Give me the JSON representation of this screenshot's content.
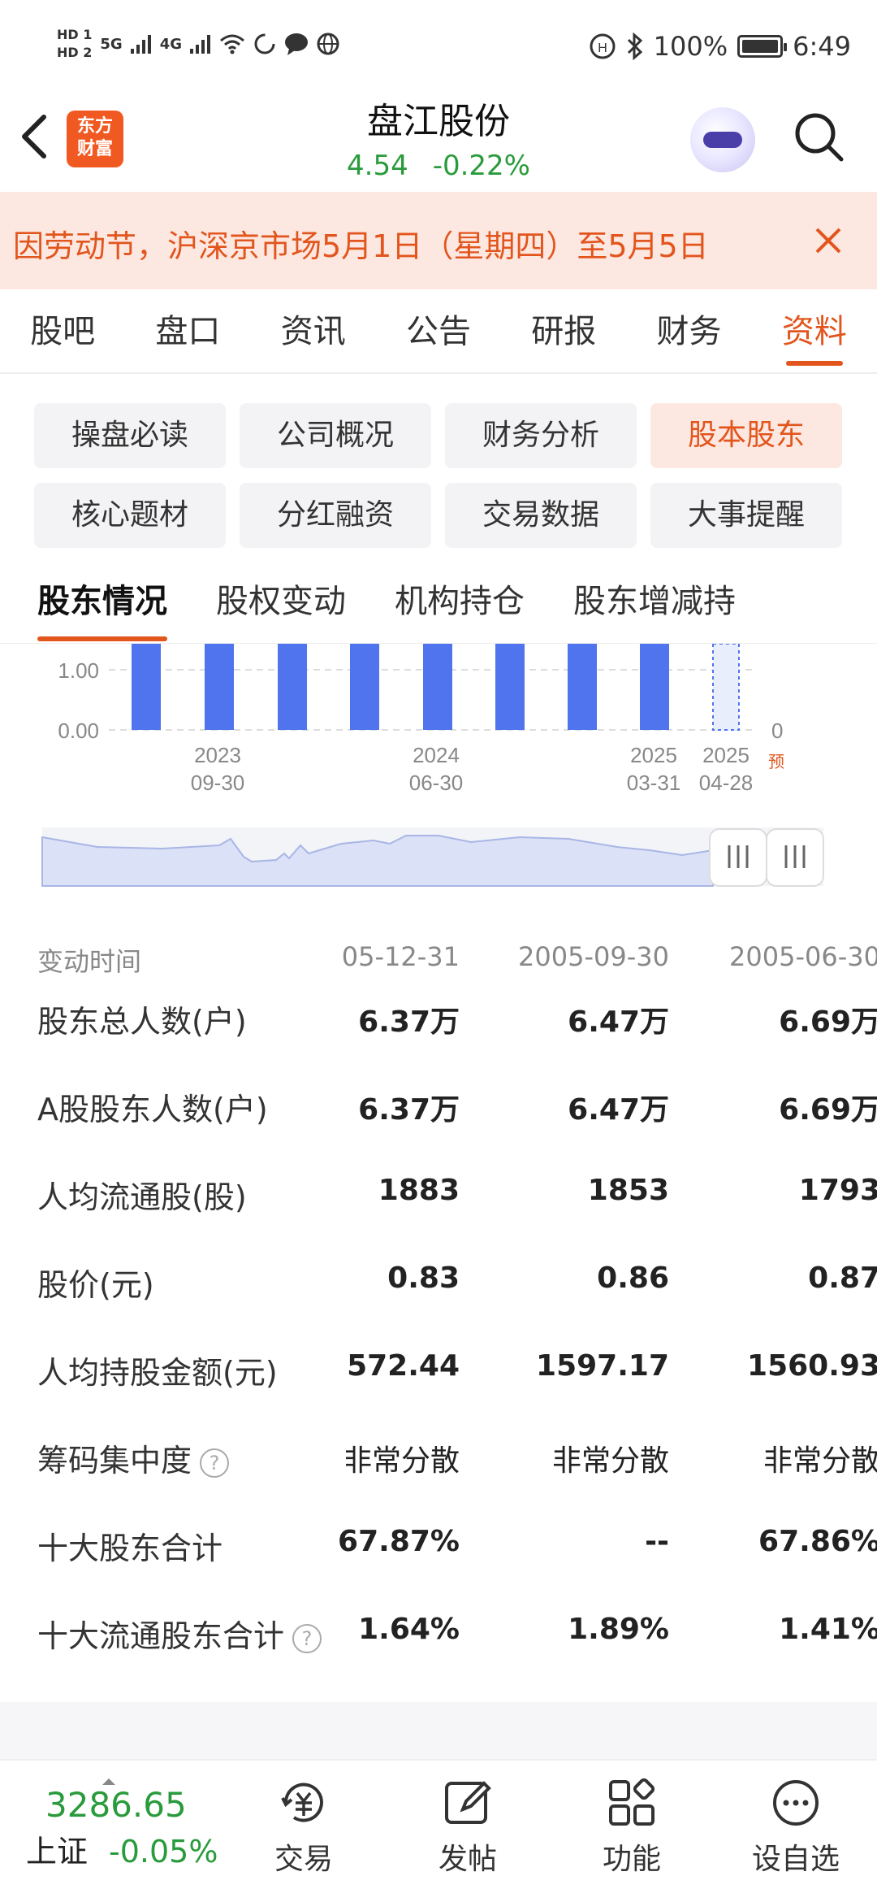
{
  "status_bar": {
    "hd1": "HD 1",
    "hd2": "HD 2",
    "net1": "5G",
    "net2": "4G",
    "battery": "100%",
    "time": "6:49"
  },
  "header": {
    "logo_line1": "东方",
    "logo_line2": "财富",
    "stock_name": "盘江股份",
    "price": "4.54",
    "change_pct": "-0.22%"
  },
  "notice": {
    "text": "因劳动节，沪深京市场5月1日（星期四）至5月5日"
  },
  "main_tabs": [
    "股吧",
    "盘口",
    "资讯",
    "公告",
    "研报",
    "财务",
    "资料"
  ],
  "sub_tabs": [
    "操盘必读",
    "公司概况",
    "财务分析",
    "股本股东",
    "核心题材",
    "分红融资",
    "交易数据",
    "大事提醒"
  ],
  "section_tabs": [
    "股东情况",
    "股权变动",
    "机构持仓",
    "股东增减持"
  ],
  "chart_data": {
    "type": "bar",
    "y_ticks_left": [
      "1.00",
      "0.00"
    ],
    "y_ticks_right": [
      "0"
    ],
    "x_labels": [
      {
        "line1": "2023",
        "line2": "09-30"
      },
      {
        "line1": "2024",
        "line2": "06-30"
      },
      {
        "line1": "2025",
        "line2": "03-31"
      },
      {
        "line1": "2025",
        "line2": "04-28"
      }
    ],
    "forecast_label": "预",
    "bar_color": "#5073ee"
  },
  "table": {
    "header": {
      "label": "变动时间",
      "cols": [
        "05-12-31",
        "2005-09-30",
        "2005-06-30"
      ]
    },
    "rows": [
      {
        "label": "股东总人数(户)",
        "values": [
          "6.37万",
          "6.47万",
          "6.69万"
        ]
      },
      {
        "label": "A股股东人数(户)",
        "values": [
          "6.37万",
          "6.47万",
          "6.69万"
        ]
      },
      {
        "label": "人均流通股(股)",
        "values": [
          "1883",
          "1853",
          "1793"
        ]
      },
      {
        "label": "股价(元)",
        "values": [
          "0.83",
          "0.86",
          "0.87"
        ]
      },
      {
        "label": "人均持股金额(元)",
        "values": [
          "572.44",
          "1597.17",
          "1560.93"
        ]
      },
      {
        "label": "筹码集中度",
        "values": [
          "非常分散",
          "非常分散",
          "非常分散"
        ],
        "help": "?"
      },
      {
        "label": "十大股东合计",
        "values": [
          "67.87%",
          "--",
          "67.86%"
        ]
      },
      {
        "label": "十大流通股东合计",
        "values": [
          "1.64%",
          "1.89%",
          "1.41%"
        ],
        "help": "?"
      }
    ]
  },
  "bottom_bar": {
    "index_value": "3286.65",
    "index_name": "上证",
    "index_change": "-0.05%",
    "items": [
      "交易",
      "发帖",
      "功能",
      "设自选"
    ]
  }
}
